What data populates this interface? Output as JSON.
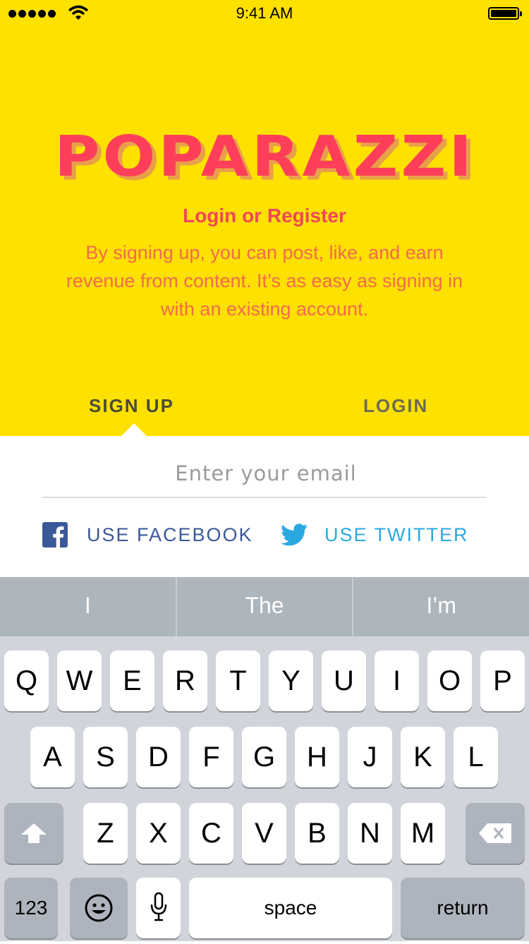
{
  "status_bar": {
    "time": "9:41 AM"
  },
  "brand": {
    "logo": "POPARAZZI",
    "subtitle": "Login or Register",
    "description": "By signing up, you can post, like, and earn revenue from content. It’s as easy as signing in with an existing account."
  },
  "tabs": {
    "sign_up": "SIGN UP",
    "login": "LOGIN",
    "active": "SIGN UP"
  },
  "email_field": {
    "placeholder": "Enter your email",
    "value": ""
  },
  "social": {
    "facebook": "USE FACEBOOK",
    "twitter": "USE TWITTER"
  },
  "colors": {
    "brand_yellow": "#FFE100",
    "logo_pink": "#FF3F5A",
    "facebook_blue": "#3B5998",
    "twitter_blue": "#2AA9E0"
  },
  "keyboard": {
    "suggestions": [
      "I",
      "The",
      "I’m"
    ],
    "row1": [
      "Q",
      "W",
      "E",
      "R",
      "T",
      "Y",
      "U",
      "I",
      "O",
      "P"
    ],
    "row2": [
      "A",
      "S",
      "D",
      "F",
      "G",
      "H",
      "J",
      "K",
      "L"
    ],
    "row3": [
      "Z",
      "X",
      "C",
      "V",
      "B",
      "N",
      "M"
    ],
    "numbers_key": "123",
    "space_key": "space",
    "return_key": "return",
    "icons": {
      "shift": "shift-icon",
      "delete": "backspace-icon",
      "emoji": "emoji-icon",
      "dictation": "microphone-icon"
    }
  }
}
